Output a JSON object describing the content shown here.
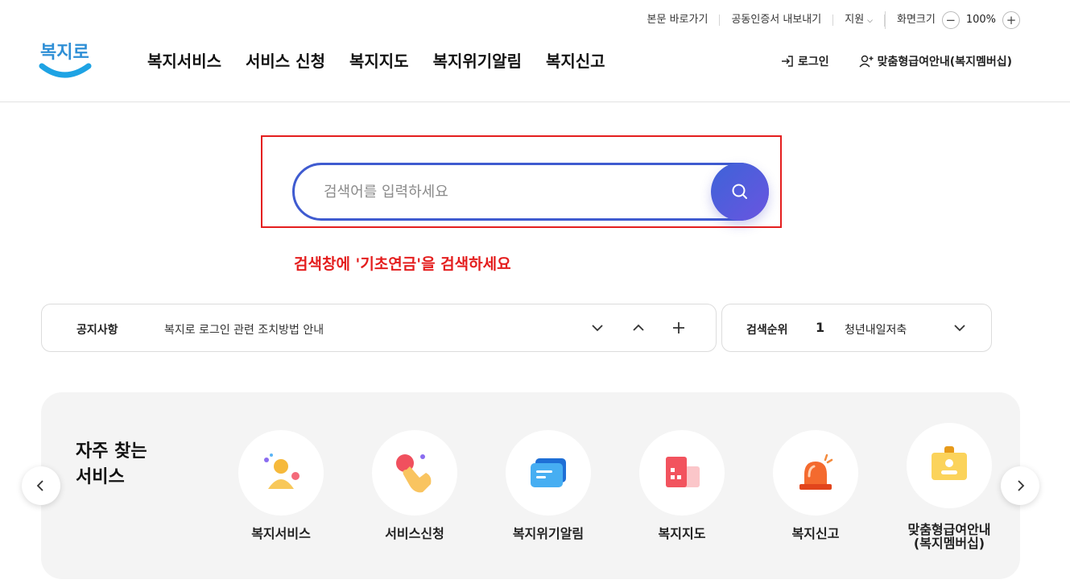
{
  "utility": {
    "skip": "본문 바로가기",
    "cert": "공동인증서 내보내기",
    "support": "지원",
    "zoom_label": "화면크기",
    "zoom_value": "100%"
  },
  "logo": {
    "text": "복지로"
  },
  "nav": {
    "items": [
      "복지서비스",
      "서비스 신청",
      "복지지도",
      "복지위기알림",
      "복지신고"
    ]
  },
  "header_right": {
    "login": "로그인",
    "membership": "맞춤형급여안내(복지멤버십)"
  },
  "search": {
    "placeholder": "검색어를 입력하세요",
    "value": ""
  },
  "instruction": "검색창에 '기초연금'을 검색하세요",
  "notice": {
    "label": "공지사항",
    "text": "복지로 로그인 관련 조치방법 안내"
  },
  "ranking": {
    "label": "검색순위",
    "number": "1",
    "text": "청년내일저축계좌"
  },
  "frequent": {
    "title_line1": "자주 찾는",
    "title_line2": "서비스",
    "items": [
      {
        "label": "복지서비스",
        "icon": "person-icon"
      },
      {
        "label": "서비스신청",
        "icon": "hand-pointer-icon"
      },
      {
        "label": "복지위기알림",
        "icon": "message-icon"
      },
      {
        "label": "복지지도",
        "icon": "building-icon"
      },
      {
        "label": "복지신고",
        "icon": "siren-icon"
      },
      {
        "label_line1": "맞춤형급여안내",
        "label_line2": "(복지멤버십)",
        "icon": "id-card-icon"
      }
    ]
  },
  "colors": {
    "brand_blue": "#3f5bd0",
    "highlight_red": "#e41e1e",
    "search_button_start": "#3d63d8",
    "search_button_end": "#6a55e0"
  }
}
